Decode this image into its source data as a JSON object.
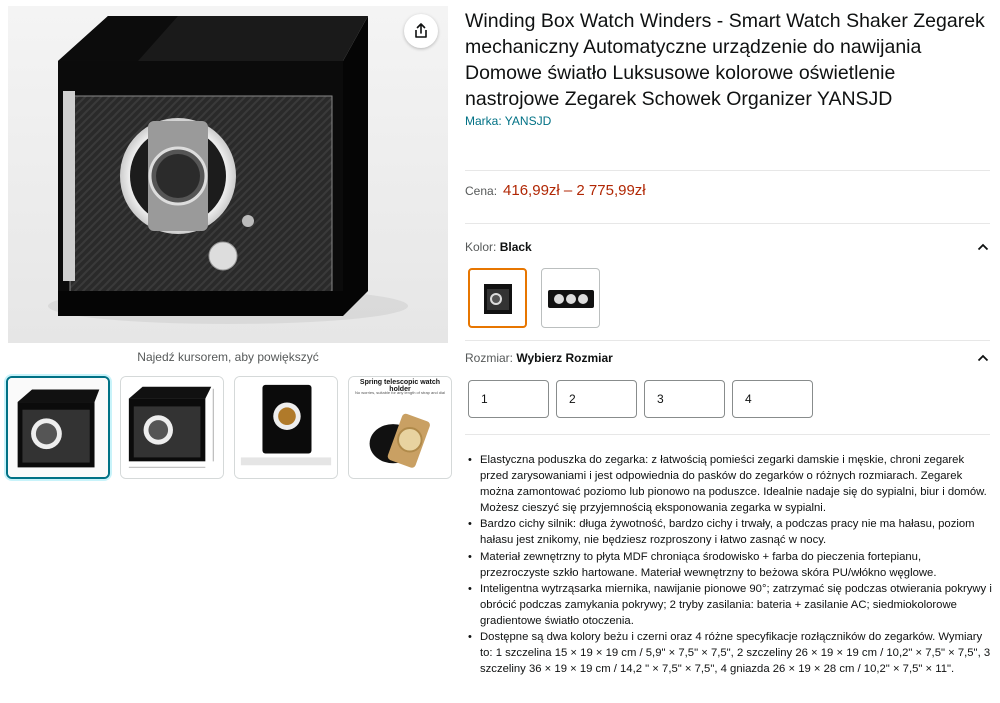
{
  "product": {
    "title": "Winding Box Watch Winders - Smart Watch Shaker Zegarek mechaniczny Automatyczne urządzenie do nawijania Domowe światło Luksusowe kolorowe oświetlenie nastrojowe Zegarek Schowek Organizer YANSJD",
    "brand": "Marka: YANSJD"
  },
  "gallery": {
    "hover_hint": "Najedź kursorem, aby powiększyć",
    "share_icon": "share-icon",
    "thumbnail_caption": "Spring telescopic watch holder",
    "thumbnail_subcaption": "No worries, suitable for any length of strap and dial"
  },
  "price": {
    "label": "Cena:",
    "value": "416,99zł – 2 775,99zł",
    "color": "#b12704"
  },
  "color_selector": {
    "label": "Kolor:",
    "value": "Black"
  },
  "size_selector": {
    "label": "Rozmiar:",
    "value": "Wybierz Rozmiar",
    "options": [
      "1",
      "2",
      "3",
      "4"
    ]
  },
  "features": [
    "Elastyczna poduszka do zegarka: z łatwością pomieści zegarki damskie i męskie, chroni zegarek przed zarysowaniami i jest odpowiednia do pasków do zegarków o różnych rozmiarach. Zegarek można zamontować poziomo lub pionowo na poduszce. Idealnie nadaje się do sypialni, biur i domów. Możesz cieszyć się przyjemnością eksponowania zegarka w sypialni.",
    "Bardzo cichy silnik: długa żywotność, bardzo cichy i trwały, a podczas pracy nie ma hałasu, poziom hałasu jest znikomy, nie będziesz rozproszony i łatwo zasnąć w nocy.",
    "Materiał zewnętrzny to płyta MDF chroniąca środowisko + farba do pieczenia fortepianu, przezroczyste szkło hartowane. Materiał wewnętrzny to beżowa skóra PU/włókno węglowe.",
    "Inteligentna wytrząsarka miernika, nawijanie pionowe 90°; zatrzymać się podczas otwierania pokrywy i obrócić podczas zamykania pokrywy; 2 tryby zasilania: bateria + zasilanie AC; siedmiokolorowe gradientowe światło otoczenia.",
    "Dostępne są dwa kolory beżu i czerni oraz 4 różne specyfikacje rozłączników do zegarków. Wymiary to: 1 szczelina 15 × 19 × 19 cm / 5,9\" × 7,5\" × 7,5\", 2 szczeliny 26 × 19 × 19 cm / 10,2\" × 7,5\" × 7,5\", 3 szczeliny 36 × 19 × 19 cm / 14,2 \" × 7,5\" × 7,5\", 4 gniazda 26 × 19 × 28 cm / 10,2\" × 7,5\" × 11\"."
  ]
}
